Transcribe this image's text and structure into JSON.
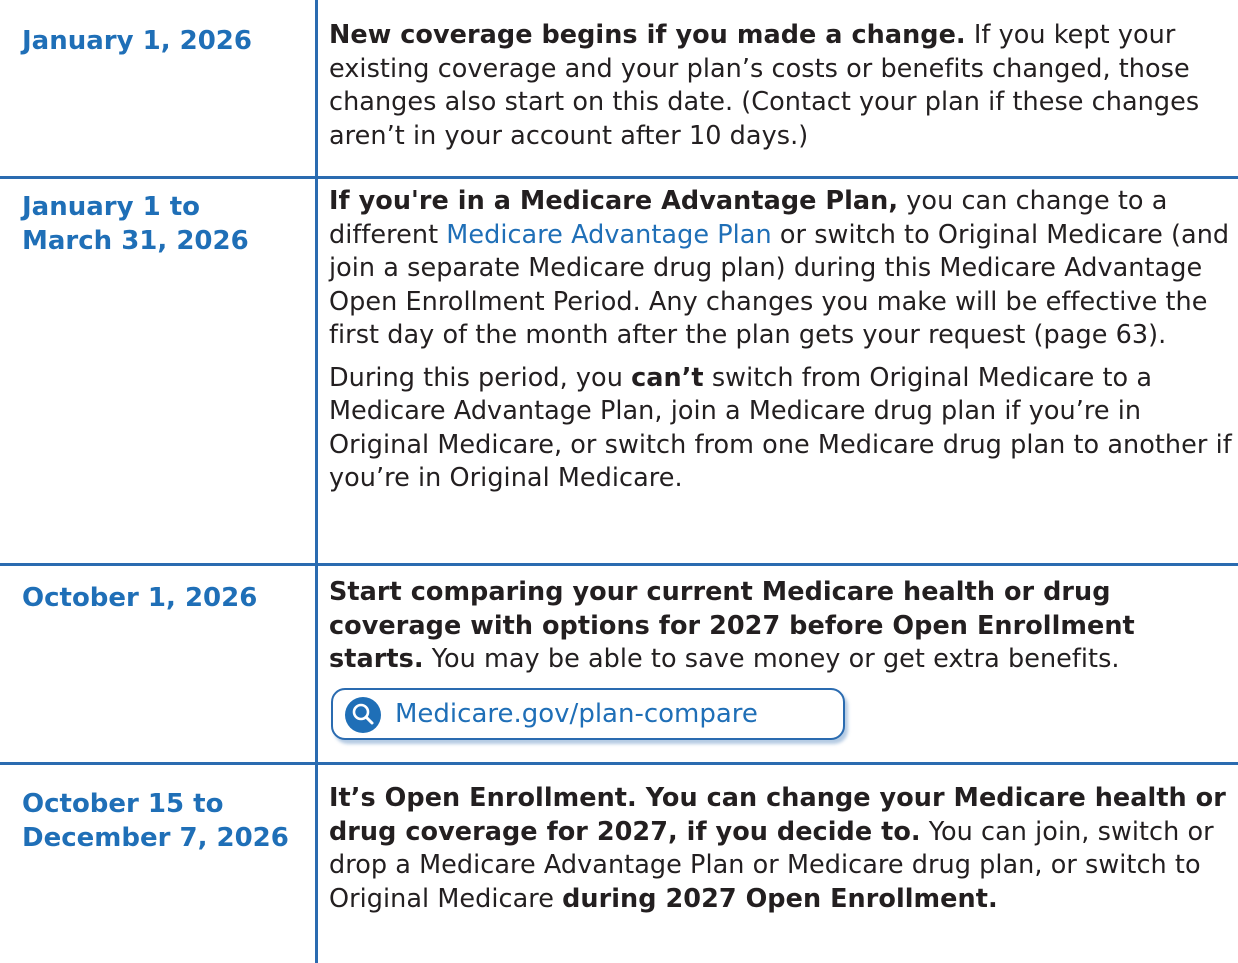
{
  "rows": [
    {
      "date": "January 1, 2026",
      "desc_bold": "New coverage begins if you made a change.",
      "desc_rest": " If you kept your existing coverage and your plan’s costs or benefits changed, those changes also start on this date. (Contact your plan if these changes aren’t in your account after 10 days.)"
    },
    {
      "date_line1": "January 1 to",
      "date_line2": "March 31, 2026",
      "p1_bold": "If you're in a Medicare Advantage Plan,",
      "p1_a": " you can change to a different ",
      "p1_link": "Medicare Advantage Plan",
      "p1_b": " or switch to Original Medicare (and join a separate Medicare drug plan) during this Medicare Advantage Open Enrollment Period. Any changes you make will be effective the first day of the month after the plan gets your request (page 63).",
      "p2_a": "During this period, you ",
      "p2_bold": "can’t",
      "p2_b": " switch from Original Medicare to a Medicare Advantage Plan, join a Medicare drug plan if you’re in Original Medicare, or switch from one Medicare drug plan to another if you’re in Original Medicare."
    },
    {
      "date": "October 1, 2026",
      "desc_bold": "Start comparing your current Medicare health or drug coverage with options for 2027 before Open Enrollment starts.",
      "desc_rest": " You may be able to save money or get extra benefits.",
      "link_text": "Medicare.gov/plan-compare",
      "link_icon": "search-icon"
    },
    {
      "date_line1": "October 15 to",
      "date_line2": "December 7, 2026",
      "desc_bold": "It’s Open Enrollment. You can change your Medicare health or drug coverage for 2027, if you decide to.",
      "desc_a": " You can join, switch or drop a Medicare Advantage Plan or Medicare drug plan, or switch to Original Medicare ",
      "desc_bold2": "during 2027 Open Enrollment."
    }
  ],
  "colors": {
    "accent": "#1f6fb7",
    "rule": "#2a6bb0",
    "text": "#231f20"
  }
}
